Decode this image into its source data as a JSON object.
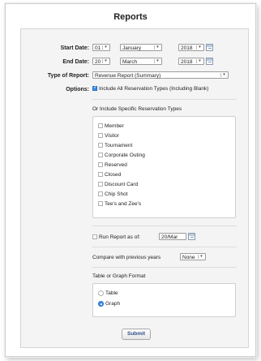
{
  "title": "Reports",
  "start_date": {
    "label": "Start Date:",
    "day": "01",
    "month": "January",
    "year": "2018"
  },
  "end_date": {
    "label": "End Date:",
    "day": "20",
    "month": "March",
    "year": "2018"
  },
  "report_type": {
    "label": "Type of Report:",
    "value": "Revenue Report (Summary)"
  },
  "options": {
    "label": "Options:",
    "include_all": "Include All Reservation Types (Including Blank)",
    "specific_heading": "Or Include Specific Reservation Types",
    "types": [
      "Member",
      "Visitor",
      "Tournament",
      "Corporate Outing",
      "Reserved",
      "Closed",
      "Discount Card",
      "Chip Shot",
      "Tee's and Zee's"
    ]
  },
  "run_report": {
    "label": "Run Report as of:",
    "value": "20/Mar"
  },
  "compare": {
    "label": "Compare with previous years",
    "value": "None"
  },
  "format": {
    "heading": "Table or Graph Format",
    "options": [
      "Table",
      "Graph"
    ],
    "selected": "Graph"
  },
  "submit_label": "Submit"
}
